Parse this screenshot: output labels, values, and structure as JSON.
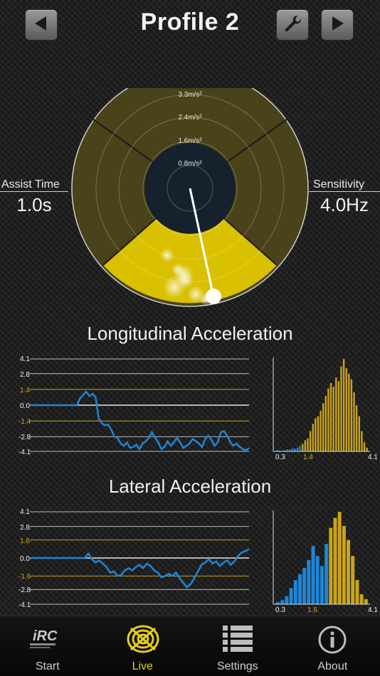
{
  "header": {
    "title": "Profile 2",
    "back_icon": "left-arrow-icon",
    "wrench_icon": "wrench-icon",
    "forward_icon": "right-arrow-icon"
  },
  "gauge": {
    "ring_labels": [
      "3.3m/s²",
      "2.4m/s²",
      "1.6m/s²",
      "0.8m/s²"
    ],
    "assist_time": {
      "label": "Assist Time",
      "value": "1.0s"
    },
    "sensitivity": {
      "label": "Sensitivity",
      "value": "4.0Hz"
    },
    "colors": {
      "zone": "#d9c000",
      "zone_dim": "#4a4218",
      "center": "#15222d"
    }
  },
  "longitudinal": {
    "title": "Longitudinal Acceleration",
    "y_ticks": [
      "4.1",
      "2.8",
      "1.4",
      "0.0",
      "-1.4",
      "-2.8",
      "-4.1"
    ],
    "threshold_tick": "1.4",
    "hist_labels": [
      "0.3",
      "1.4",
      "4.1"
    ],
    "chart_data": {
      "type": "line",
      "ylim": [
        -4.1,
        4.1
      ],
      "values": [
        0.0,
        0.0,
        0.0,
        0.0,
        0.0,
        0.0,
        0.0,
        0.0,
        0.0,
        0.0,
        0.0,
        0.0,
        0.0,
        0.0,
        0.0,
        0.0,
        0.6,
        0.9,
        1.2,
        0.8,
        1.0,
        0.7,
        -1.2,
        -1.6,
        -1.8,
        -1.7,
        -2.2,
        -2.8,
        -2.9,
        -3.4,
        -3.6,
        -3.3,
        -3.8,
        -3.7,
        -3.5,
        -3.9,
        -3.4,
        -3.2,
        -2.9,
        -2.4,
        -2.9,
        -3.3,
        -3.9,
        -3.7,
        -3.2,
        -3.6,
        -3.3,
        -2.9,
        -3.3,
        -3.8,
        -3.6,
        -3.4,
        -3.0,
        -3.2,
        -3.4,
        -3.7,
        -3.0,
        -2.7,
        -3.1,
        -3.6,
        -3.3,
        -2.4,
        -2.3,
        -2.7,
        -3.3,
        -3.6,
        -3.4,
        -3.7,
        -3.9,
        -4.0,
        -3.8
      ],
      "color": "#1f86d6",
      "threshold_color": "#c9a41a"
    },
    "histogram": {
      "type": "bar",
      "values": [
        1,
        1,
        0,
        1,
        2,
        2,
        3,
        3,
        4,
        6,
        8,
        12,
        14,
        22,
        30,
        36,
        38,
        44,
        52,
        60,
        68,
        74,
        70,
        80,
        76,
        92,
        100,
        90,
        84,
        78,
        64,
        50,
        38,
        22,
        10,
        4
      ],
      "threshold_index": 10,
      "colors": [
        "#1f86d6",
        "#c9a41a"
      ]
    }
  },
  "lateral": {
    "title": "Lateral Acceleration",
    "y_ticks": [
      "4.1",
      "2.8",
      "1.6",
      "0.0",
      "-1.6",
      "-2.8",
      "-4.1"
    ],
    "threshold_tick": "1.6",
    "hist_labels": [
      "0.3",
      "1.6",
      "4.1"
    ],
    "chart_data": {
      "type": "line",
      "ylim": [
        -4.1,
        4.1
      ],
      "values": [
        0.0,
        0.0,
        0.0,
        0.0,
        0.0,
        0.0,
        0.0,
        0.0,
        0.0,
        0.0,
        0.0,
        0.0,
        0.0,
        0.0,
        0.0,
        0.0,
        0.4,
        -0.1,
        -0.4,
        -0.2,
        -0.5,
        -0.8,
        -1.3,
        -1.2,
        -1.6,
        -1.5,
        -1.1,
        -0.9,
        -1.1,
        -0.8,
        -0.6,
        -0.9,
        -0.5,
        -0.7,
        -1.1,
        -1.3,
        -1.7,
        -1.6,
        -1.4,
        -1.6,
        -1.3,
        -1.8,
        -2.2,
        -2.6,
        -2.3,
        -1.8,
        -1.2,
        -0.6,
        -0.4,
        -0.1,
        -0.5,
        -0.3,
        -0.7,
        -0.4,
        -0.2,
        -0.6,
        -0.3,
        0.2,
        0.5,
        0.6,
        0.8
      ],
      "color": "#1f86d6",
      "threshold_color": "#c9a41a"
    },
    "histogram": {
      "type": "bar",
      "values": [
        2,
        4,
        8,
        16,
        24,
        30,
        36,
        44,
        58,
        48,
        38,
        60,
        76,
        86,
        92,
        78,
        64,
        48,
        24,
        10,
        5
      ],
      "threshold_index": 12,
      "colors": [
        "#1f86d6",
        "#c9a41a"
      ]
    }
  },
  "tabs": [
    {
      "label": "Start",
      "icon": "irc-logo-icon"
    },
    {
      "label": "Live",
      "icon": "live-target-icon",
      "active_color": "#e6cf1a"
    },
    {
      "label": "Settings",
      "icon": "settings-list-icon"
    },
    {
      "label": "About",
      "icon": "info-icon"
    }
  ]
}
